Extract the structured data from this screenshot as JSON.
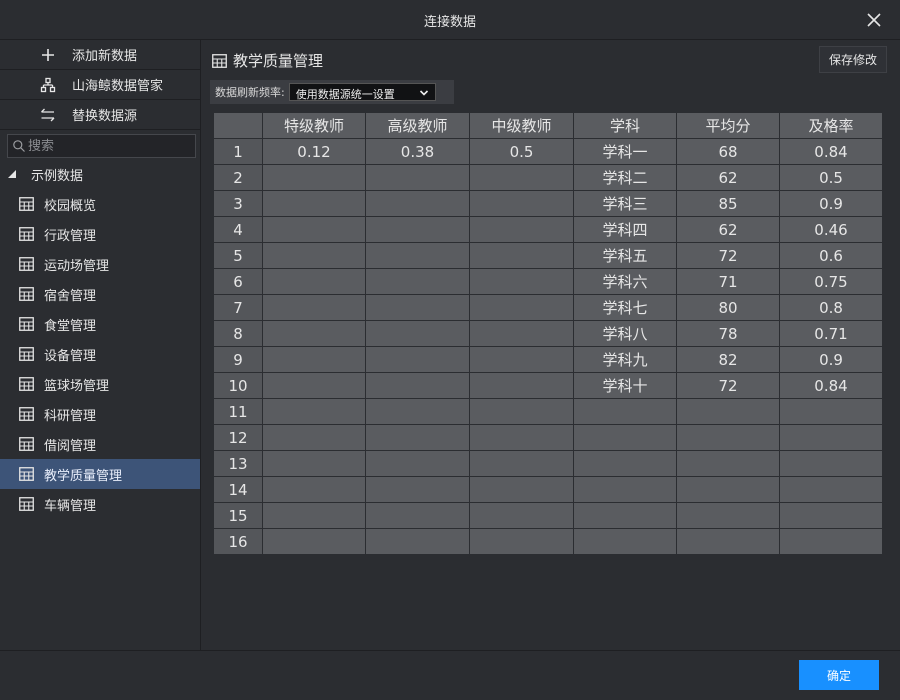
{
  "window": {
    "title": "连接数据",
    "close_icon": "close-icon"
  },
  "sidebar": {
    "actions": [
      {
        "label": "添加新数据",
        "icon": "plus-icon"
      },
      {
        "label": "山海鲸数据管家",
        "icon": "hierarchy-icon"
      },
      {
        "label": "替换数据源",
        "icon": "swap-icon"
      }
    ],
    "search": {
      "placeholder": "搜索"
    },
    "root": {
      "label": "示例数据",
      "icon": "triangle-icon"
    },
    "items": [
      {
        "label": "校园概览",
        "active": false
      },
      {
        "label": "行政管理",
        "active": false
      },
      {
        "label": "运动场管理",
        "active": false
      },
      {
        "label": "宿舍管理",
        "active": false
      },
      {
        "label": "食堂管理",
        "active": false
      },
      {
        "label": "设备管理",
        "active": false
      },
      {
        "label": "篮球场管理",
        "active": false
      },
      {
        "label": "科研管理",
        "active": false
      },
      {
        "label": "借阅管理",
        "active": false
      },
      {
        "label": "教学质量管理",
        "active": true
      },
      {
        "label": "车辆管理",
        "active": false
      }
    ]
  },
  "main": {
    "title": "教学质量管理",
    "save_label": "保存修改",
    "freq_label": "数据刷新频率:",
    "freq_value": "使用数据源统一设置"
  },
  "table": {
    "headers": [
      "特级教师",
      "高级教师",
      "中级教师",
      "学科",
      "平均分",
      "及格率"
    ],
    "rows": [
      [
        "1",
        "0.12",
        "0.38",
        "0.5",
        "学科一",
        "68",
        "0.84"
      ],
      [
        "2",
        "",
        "",
        "",
        "学科二",
        "62",
        "0.5"
      ],
      [
        "3",
        "",
        "",
        "",
        "学科三",
        "85",
        "0.9"
      ],
      [
        "4",
        "",
        "",
        "",
        "学科四",
        "62",
        "0.46"
      ],
      [
        "5",
        "",
        "",
        "",
        "学科五",
        "72",
        "0.6"
      ],
      [
        "6",
        "",
        "",
        "",
        "学科六",
        "71",
        "0.75"
      ],
      [
        "7",
        "",
        "",
        "",
        "学科七",
        "80",
        "0.8"
      ],
      [
        "8",
        "",
        "",
        "",
        "学科八",
        "78",
        "0.71"
      ],
      [
        "9",
        "",
        "",
        "",
        "学科九",
        "82",
        "0.9"
      ],
      [
        "10",
        "",
        "",
        "",
        "学科十",
        "72",
        "0.84"
      ],
      [
        "11",
        "",
        "",
        "",
        "",
        "",
        ""
      ],
      [
        "12",
        "",
        "",
        "",
        "",
        "",
        ""
      ],
      [
        "13",
        "",
        "",
        "",
        "",
        "",
        ""
      ],
      [
        "14",
        "",
        "",
        "",
        "",
        "",
        ""
      ],
      [
        "15",
        "",
        "",
        "",
        "",
        "",
        ""
      ],
      [
        "16",
        "",
        "",
        "",
        "",
        "",
        ""
      ]
    ]
  },
  "footer": {
    "ok_label": "确定"
  },
  "colors": {
    "accent": "#1890ff",
    "active_item": "#3d5478",
    "cell": "#5a5c60",
    "background": "#2b2d31"
  }
}
